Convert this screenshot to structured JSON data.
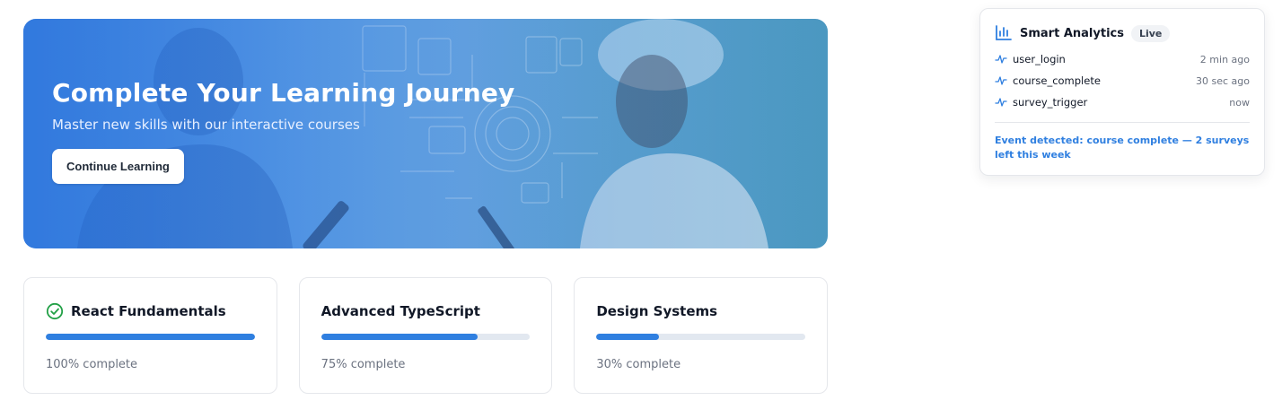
{
  "hero": {
    "title": "Complete Your Learning Journey",
    "subtitle": "Master new skills with our interactive courses",
    "button_label": "Continue Learning"
  },
  "courses": [
    {
      "title": "React Fundamentals",
      "progress": 100,
      "meta": "100% complete",
      "completed": true
    },
    {
      "title": "Advanced TypeScript",
      "progress": 75,
      "meta": "75% complete",
      "completed": false
    },
    {
      "title": "Design Systems",
      "progress": 30,
      "meta": "30% complete",
      "completed": false
    }
  ],
  "analytics": {
    "title": "Smart Analytics",
    "badge": "Live",
    "events": [
      {
        "name": "user_login",
        "time": "2 min ago"
      },
      {
        "name": "course_complete",
        "time": "30 sec ago"
      },
      {
        "name": "survey_trigger",
        "time": "now"
      }
    ],
    "notice": "Event detected: course complete — 2 surveys left this week"
  },
  "colors": {
    "accent": "#2f7fe0",
    "success": "#22a046",
    "track": "#e2e8f0"
  }
}
